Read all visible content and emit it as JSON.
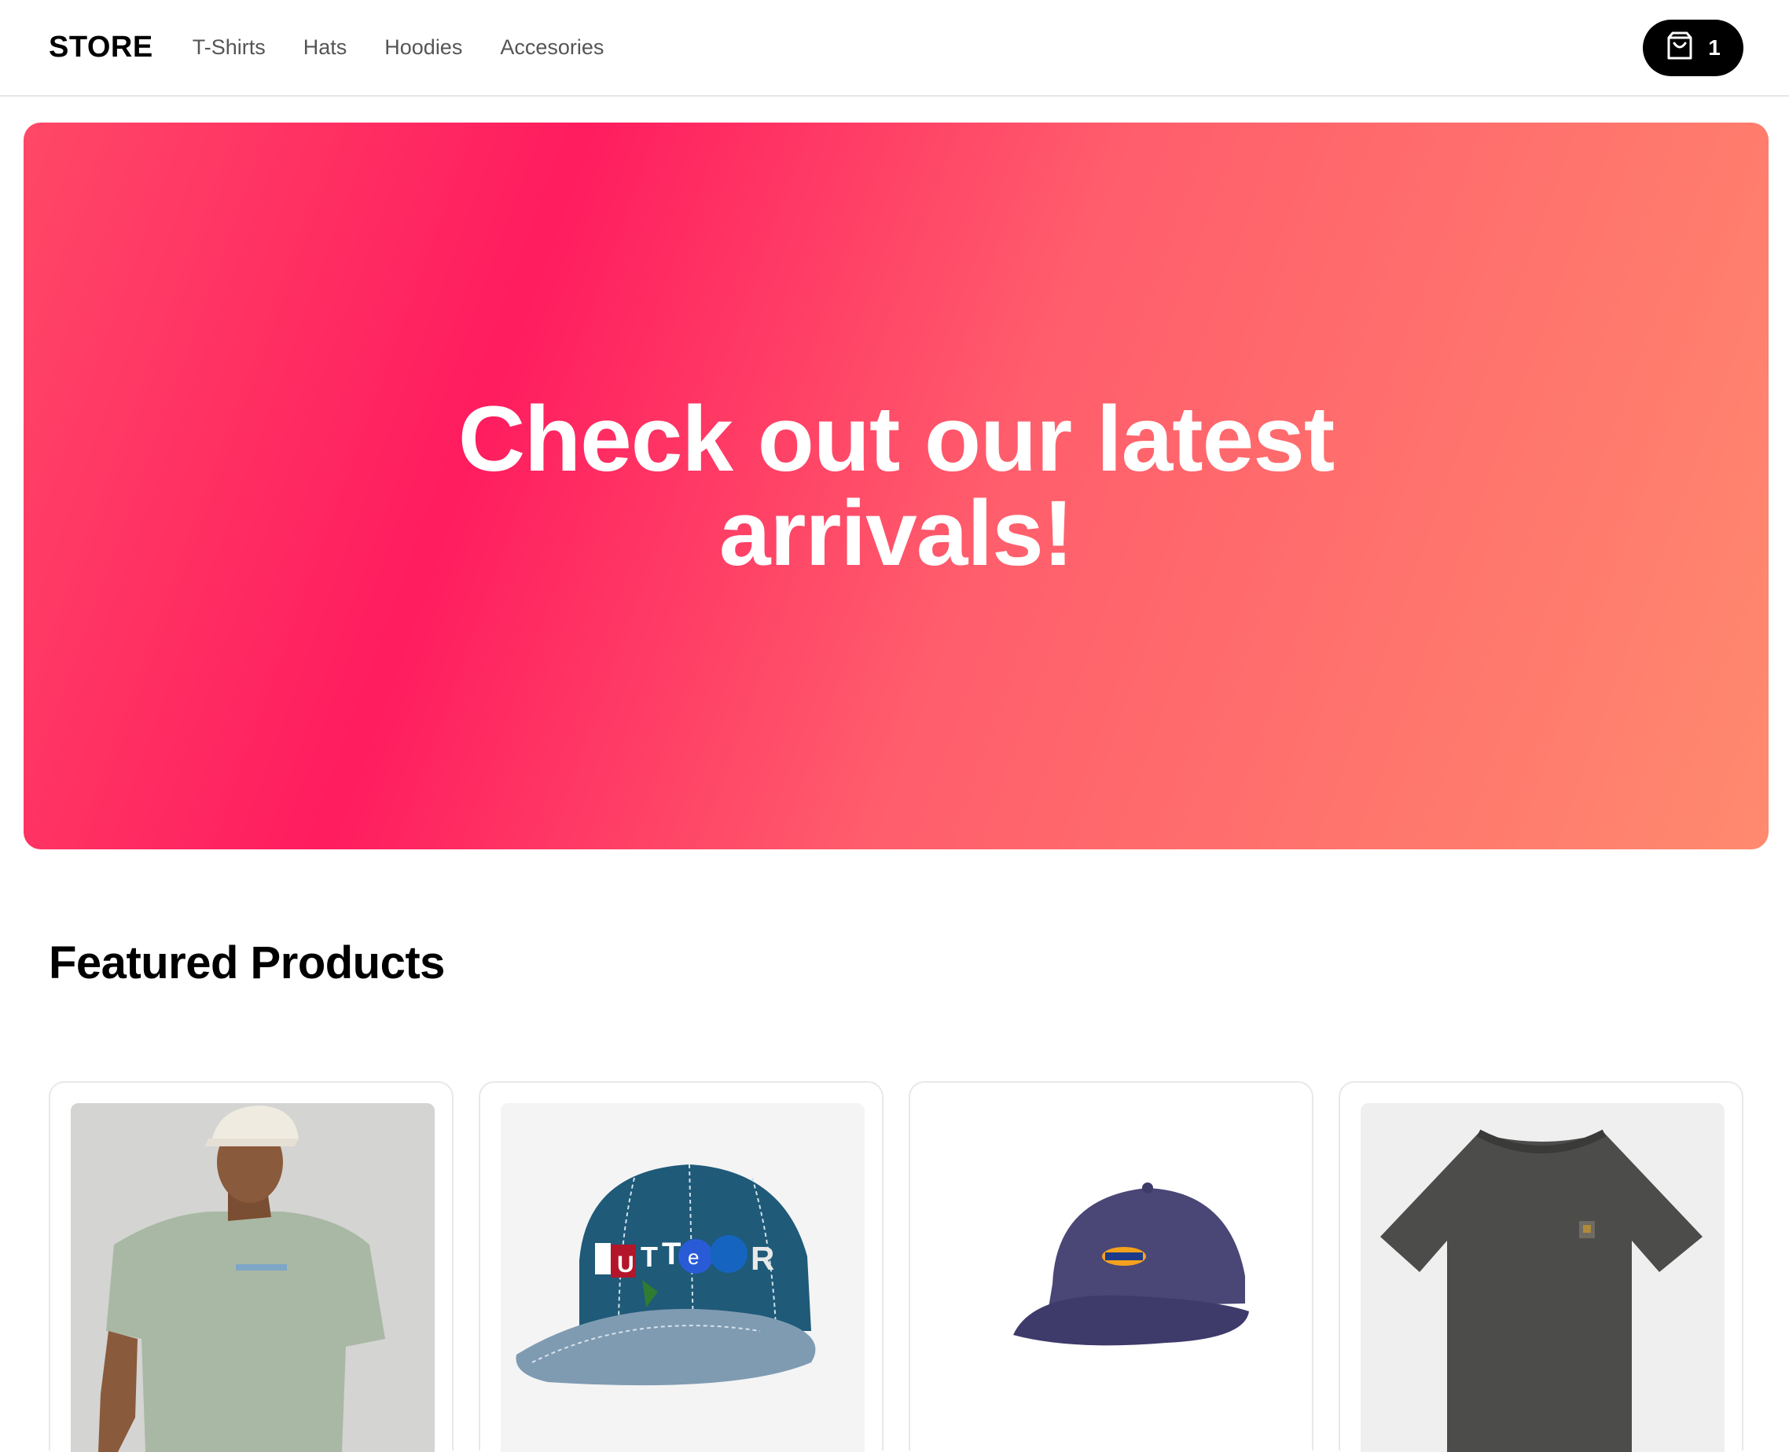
{
  "header": {
    "logo": "STORE",
    "nav": [
      {
        "label": "T-Shirts"
      },
      {
        "label": "Hats"
      },
      {
        "label": "Hoodies"
      },
      {
        "label": "Accesories"
      }
    ],
    "cart": {
      "icon": "shopping-bag-icon",
      "count": "1"
    }
  },
  "hero": {
    "title": "Check out our latest arrivals!",
    "gradient": [
      "#ff4867",
      "#ff1c5f",
      "#ff5d6c",
      "#ff8a6e"
    ]
  },
  "featured": {
    "title": "Featured Products",
    "products": [
      {
        "image": "model-wearing-sage-tshirt-and-cap"
      },
      {
        "image": "blue-butter-cap"
      },
      {
        "image": "navy-dickies-cap"
      },
      {
        "image": "charcoal-pocket-tshirt"
      }
    ]
  },
  "cap_text": {
    "b": "U",
    "t1": "T",
    "t2": "T",
    "e": "e",
    "r": "R"
  }
}
